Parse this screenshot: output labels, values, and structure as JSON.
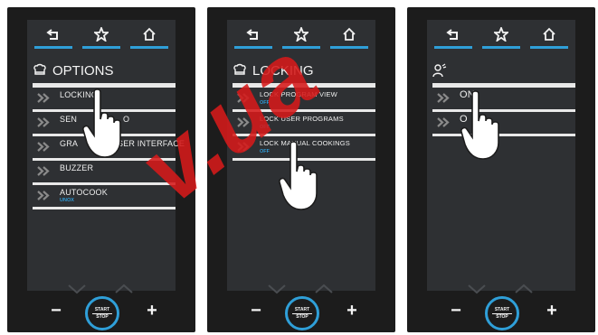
{
  "nav": {
    "back_icon": "back-arrow-icon",
    "favorite_icon": "star-icon",
    "home_icon": "home-icon"
  },
  "panels": [
    {
      "title": "OPTIONS",
      "title_icon": "chef-hat-icon",
      "items": [
        {
          "label": "LOCKING"
        },
        {
          "label": "SEN"
        },
        {
          "label": "GRA"
        },
        {
          "label": "BUZZER"
        },
        {
          "label": "AUTOCOOK",
          "sub": "UNOX"
        }
      ],
      "right_fragments": {
        "item2": "O",
        "item3": "SER INTERFACE"
      }
    },
    {
      "title": "LOCKING",
      "title_icon": "chef-hat-icon",
      "items": [
        {
          "label": "LOCK PROGRAM VIEW",
          "sub": "OFF"
        },
        {
          "label": "LOCK USER PROGRAMS",
          "sub": "OFF"
        },
        {
          "label": "LOCK MANUAL COOKINGS",
          "sub": "OFF"
        }
      ]
    },
    {
      "title": "",
      "title_icon": "user-lock-icon",
      "items": [
        {
          "label": "ON"
        },
        {
          "label": "O"
        }
      ]
    }
  ],
  "controls": {
    "minus": "−",
    "plus": "+",
    "start": "START",
    "stop": "STOP"
  },
  "watermark": "v.ua",
  "colors": {
    "accent": "#2f9fd8",
    "screen": "#2e3033",
    "frame": "#1c1c1c",
    "watermark": "#d61a1a"
  }
}
